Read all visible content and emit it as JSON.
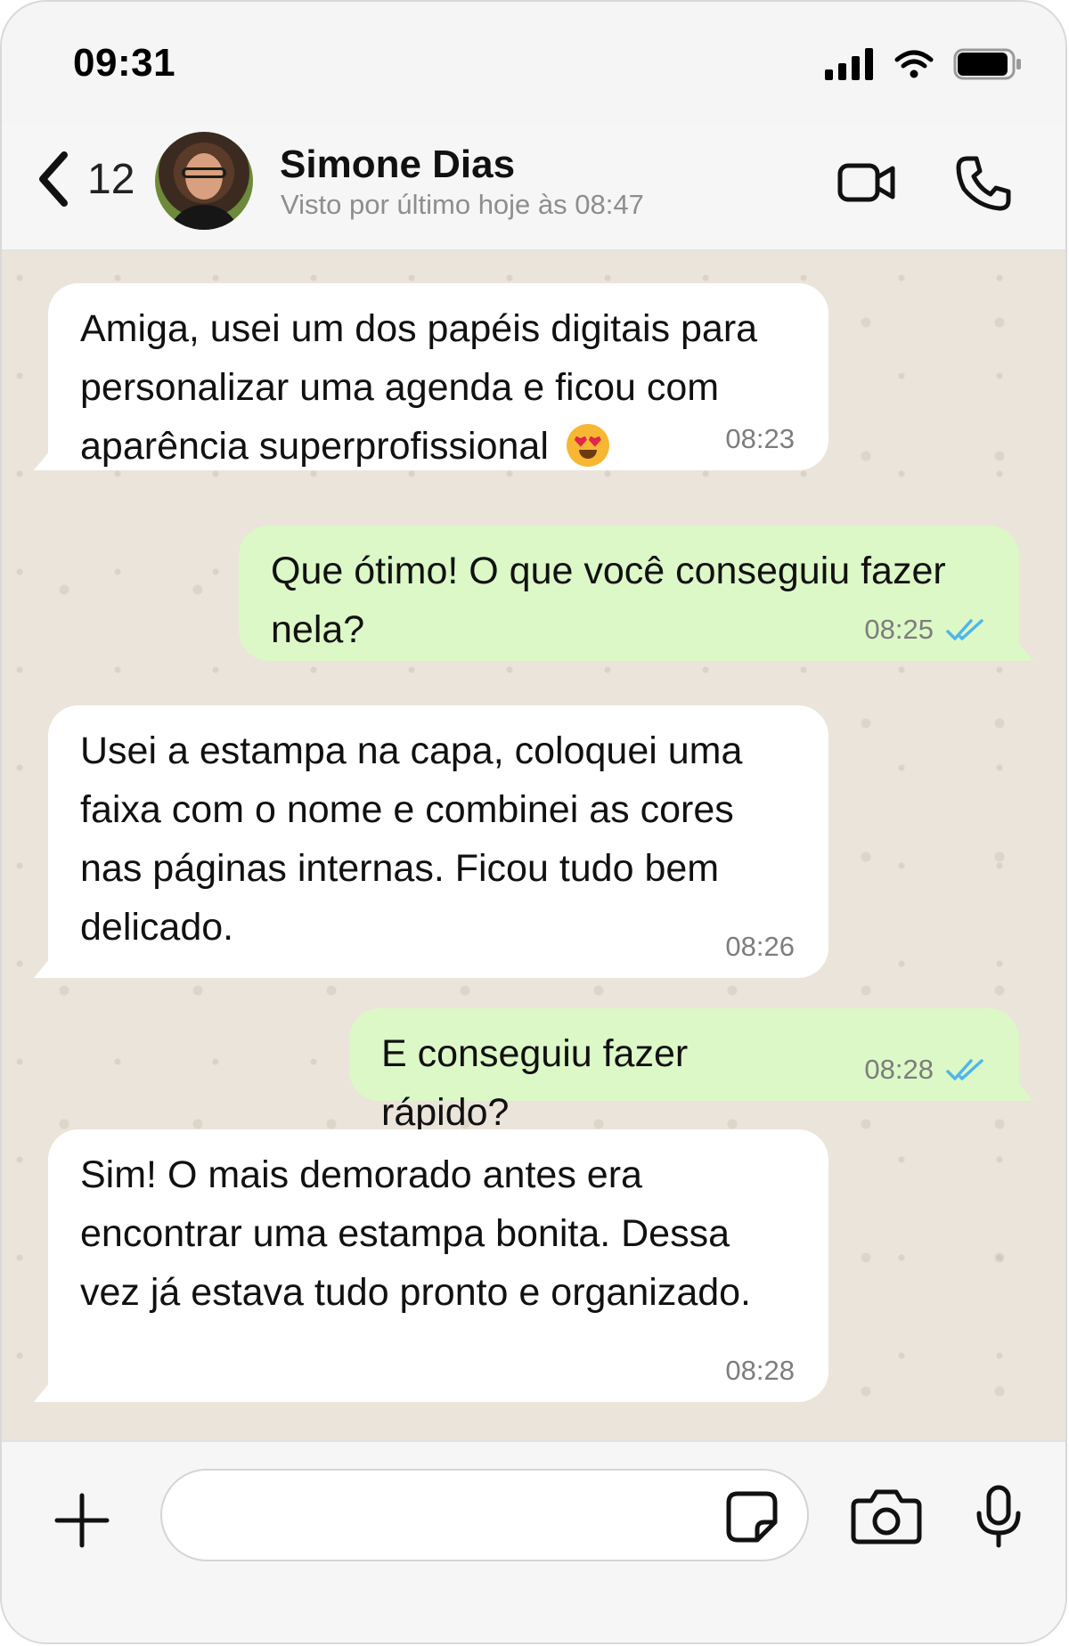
{
  "status_bar": {
    "time": "09:31"
  },
  "header": {
    "back_count": "12",
    "contact_name": "Simone Dias",
    "last_seen": "Visto por último hoje às 08:47"
  },
  "messages": [
    {
      "direction": "in",
      "text": "Amiga, usei um dos papéis digitais para personalizar uma agenda e ficou com aparência superprofissional",
      "emoji": "smiling-face-with-heart-eyes",
      "time": "08:23"
    },
    {
      "direction": "out",
      "text": "Que ótimo! O que você conseguiu fazer nela?",
      "time": "08:25",
      "read": true
    },
    {
      "direction": "in",
      "text": "Usei a estampa na capa, coloquei uma faixa com o nome e combinei as cores nas páginas internas. Ficou tudo bem delicado.",
      "time": "08:26"
    },
    {
      "direction": "out",
      "text": "E conseguiu fazer rápido?",
      "time": "08:28",
      "read": true
    },
    {
      "direction": "in",
      "text": "Sim! O mais demorado antes era encontrar uma estampa bonita. Dessa vez já estava tudo pronto e organizado.",
      "time": "08:28"
    }
  ],
  "input": {
    "value": "",
    "placeholder": ""
  },
  "colors": {
    "incoming_bubble": "#ffffff",
    "outgoing_bubble": "#dcf8c6",
    "chat_background": "#ebe4db",
    "read_ticks": "#4fb6ec"
  },
  "icons": [
    "back-chevron-icon",
    "video-call-icon",
    "phone-icon",
    "plus-icon",
    "sticker-icon",
    "camera-icon",
    "microphone-icon",
    "signal-icon",
    "wifi-icon",
    "battery-icon",
    "double-check-icon"
  ]
}
